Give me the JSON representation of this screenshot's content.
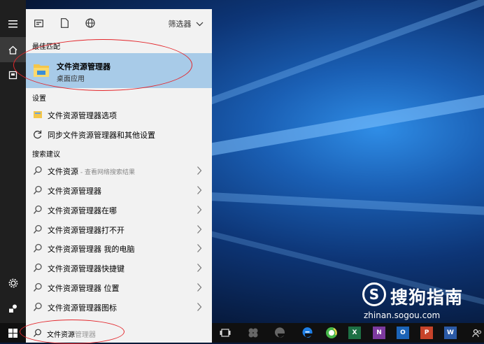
{
  "start_menu": {
    "filter_label": "筛选器",
    "best_match": {
      "section_label": "最佳匹配",
      "title": "文件资源管理器",
      "subtitle": "桌面应用"
    },
    "settings": {
      "section_label": "设置",
      "items": [
        {
          "label": "文件资源管理器选项",
          "icon": "folder-options-icon"
        },
        {
          "label": "同步文件资源管理器和其他设置",
          "icon": "sync-icon"
        }
      ]
    },
    "suggestions": {
      "section_label": "搜索建议",
      "web_item": {
        "label": "文件资源",
        "hint": " - 查看网络搜索结果"
      },
      "items": [
        "文件资源管理器",
        "文件资源管理器在哪",
        "文件资源管理器打不开",
        "文件资源管理器 我的电脑",
        "文件资源管理器快捷键",
        "文件资源管理器 位置",
        "文件资源管理器图标"
      ]
    }
  },
  "taskbar": {
    "search_typed": "文件资源",
    "search_autocomplete": "管理器",
    "apps": [
      "task-view-icon",
      "app-icon",
      "edge-legacy-icon",
      "edge-icon",
      "qq-browser-icon",
      "excel-icon",
      "onenote-icon",
      "outlook-icon",
      "powerpoint-icon",
      "word-icon",
      "people-icon"
    ]
  },
  "watermark": {
    "logo_letter": "S",
    "name": "搜狗指南",
    "url": "zhinan.sogou.com"
  },
  "colors": {
    "highlight": "#a8cbe8",
    "annotation": "#e3262b"
  }
}
